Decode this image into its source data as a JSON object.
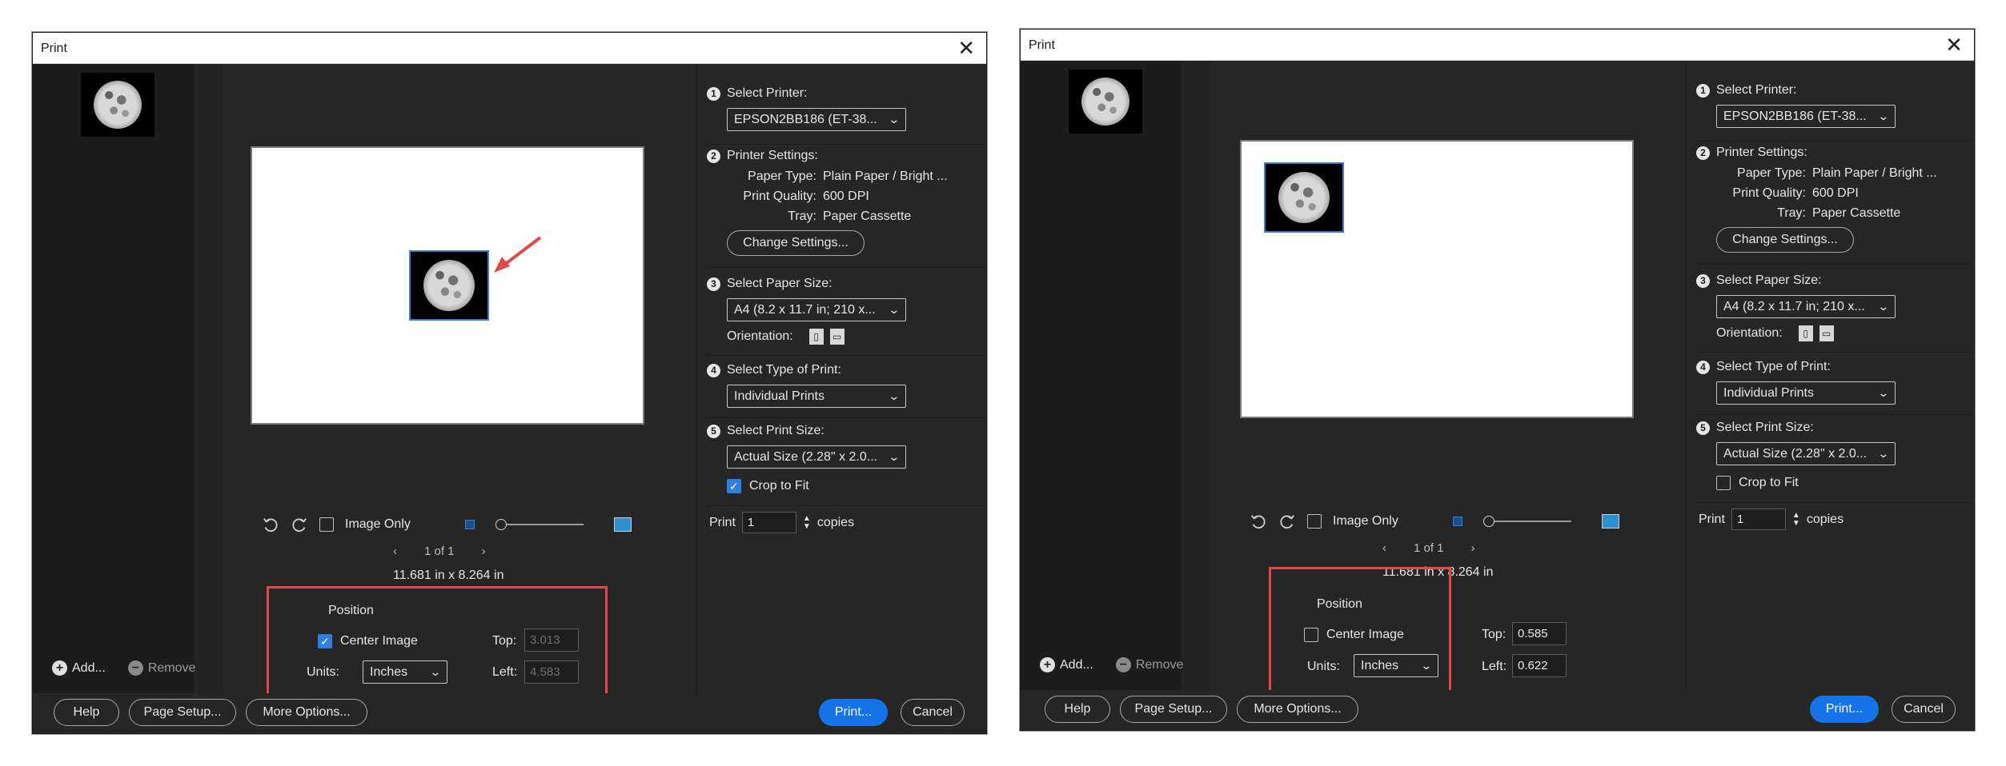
{
  "dialogs": [
    {
      "title": "Print",
      "thumb_alt": "moon",
      "add_label": "Add...",
      "remove_label": "Remove",
      "image_only_label": "Image Only",
      "image_only_checked": false,
      "page_indicator": "1 of 1",
      "paper_dimensions": "11.681 in x 8.264 in",
      "position": {
        "title": "Position",
        "center_image_label": "Center Image",
        "center_image_checked": true,
        "units_label": "Units:",
        "units_value": "Inches",
        "top_label": "Top:",
        "top_value": "3.013",
        "left_label": "Left:",
        "left_value": "4.583"
      },
      "buttons": {
        "help": "Help",
        "page_setup": "Page Setup...",
        "more_options": "More Options...",
        "print": "Print...",
        "cancel": "Cancel"
      },
      "steps": {
        "s1_num": "1",
        "s1_label": "Select Printer:",
        "printer": "EPSON2BB186 (ET-38...",
        "s2_num": "2",
        "s2_label": "Printer Settings:",
        "paper_type_label": "Paper Type:",
        "paper_type": "Plain Paper / Bright ...",
        "print_quality_label": "Print Quality:",
        "print_quality": "600 DPI",
        "tray_label": "Tray:",
        "tray": "Paper Cassette",
        "change_settings": "Change Settings...",
        "s3_num": "3",
        "s3_label": "Select Paper Size:",
        "paper_size": "A4 (8.2 x 11.7 in; 210 x...",
        "orientation_label": "Orientation:",
        "s4_num": "4",
        "s4_label": "Select Type of Print:",
        "print_type": "Individual Prints",
        "s5_num": "5",
        "s5_label": "Select Print Size:",
        "print_size": "Actual Size (2.28\" x 2.0...",
        "crop_to_fit_label": "Crop to Fit",
        "crop_to_fit_checked": true,
        "print_label": "Print",
        "copies_value": "1",
        "copies_label": "copies"
      }
    },
    {
      "title": "Print",
      "thumb_alt": "moon",
      "add_label": "Add...",
      "remove_label": "Remove",
      "image_only_label": "Image Only",
      "image_only_checked": false,
      "page_indicator": "1 of 1",
      "paper_dimensions": "11.681 in x 8.264 in",
      "position": {
        "title": "Position",
        "center_image_label": "Center Image",
        "center_image_checked": false,
        "units_label": "Units:",
        "units_value": "Inches",
        "top_label": "Top:",
        "top_value": "0.585",
        "left_label": "Left:",
        "left_value": "0.622"
      },
      "buttons": {
        "help": "Help",
        "page_setup": "Page Setup...",
        "more_options": "More Options...",
        "print": "Print...",
        "cancel": "Cancel"
      },
      "steps": {
        "s1_num": "1",
        "s1_label": "Select Printer:",
        "printer": "EPSON2BB186 (ET-38...",
        "s2_num": "2",
        "s2_label": "Printer Settings:",
        "paper_type_label": "Paper Type:",
        "paper_type": "Plain Paper / Bright ...",
        "print_quality_label": "Print Quality:",
        "print_quality": "600 DPI",
        "tray_label": "Tray:",
        "tray": "Paper Cassette",
        "change_settings": "Change Settings...",
        "s3_num": "3",
        "s3_label": "Select Paper Size:",
        "paper_size": "A4 (8.2 x 11.7 in; 210 x...",
        "orientation_label": "Orientation:",
        "s4_num": "4",
        "s4_label": "Select Type of Print:",
        "print_type": "Individual Prints",
        "s5_num": "5",
        "s5_label": "Select Print Size:",
        "print_size": "Actual Size (2.28\" x 2.0...",
        "crop_to_fit_label": "Crop to Fit",
        "crop_to_fit_checked": false,
        "print_label": "Print",
        "copies_value": "1",
        "copies_label": "copies"
      }
    }
  ],
  "colors": {
    "dialog_bg": "#262626",
    "accent_blue": "#1473e6",
    "annotation_red": "#e04a4a"
  }
}
